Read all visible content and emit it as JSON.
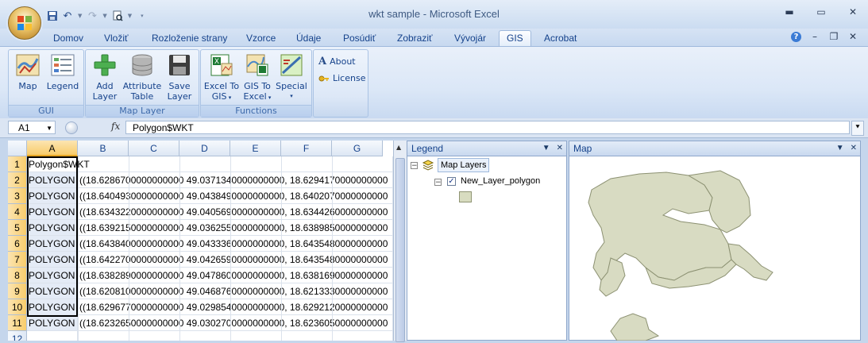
{
  "window": {
    "title": "wkt sample - Microsoft Excel",
    "controls": [
      "minimize",
      "maximize",
      "close"
    ]
  },
  "qat": {
    "items": [
      "save-icon",
      "undo-icon",
      "redo-icon",
      "print-preview-icon",
      "customize-icon"
    ]
  },
  "tabs": [
    {
      "label": "Domov"
    },
    {
      "label": "Vložiť"
    },
    {
      "label": "Rozloženie strany"
    },
    {
      "label": "Vzorce"
    },
    {
      "label": "Údaje"
    },
    {
      "label": "Posúdiť"
    },
    {
      "label": "Zobraziť"
    },
    {
      "label": "Vývojár"
    },
    {
      "label": "GIS",
      "active": true
    },
    {
      "label": "Acrobat"
    }
  ],
  "ribbon": {
    "groups": {
      "gui": {
        "label": "GUI",
        "buttons": [
          {
            "label": "Map",
            "icon": "map-icon"
          },
          {
            "label": "Legend",
            "icon": "legend-icon"
          }
        ]
      },
      "map_layer": {
        "label": "Map Layer",
        "buttons": [
          {
            "label_line1": "Add",
            "label_line2": "Layer",
            "icon": "add-icon"
          },
          {
            "label_line1": "Attribute",
            "label_line2": "Table",
            "icon": "database-icon"
          },
          {
            "label_line1": "Save",
            "label_line2": "Layer",
            "icon": "floppy-icon"
          }
        ]
      },
      "functions": {
        "label": "Functions",
        "buttons": [
          {
            "label_line1": "Excel To",
            "label_line2": "GIS",
            "icon": "excel-to-gis-icon"
          },
          {
            "label_line1": "GIS To",
            "label_line2": "Excel",
            "icon": "gis-to-excel-icon"
          },
          {
            "label_line1": "Special",
            "label_line2": "",
            "icon": "special-icon"
          }
        ]
      },
      "info": {
        "about": "About",
        "license": "License"
      }
    }
  },
  "formula_bar": {
    "name_box": "A1",
    "fx": "fx",
    "formula": "Polygon$WKT"
  },
  "sheet": {
    "columns": [
      "A",
      "B",
      "C",
      "D",
      "E",
      "F",
      "G"
    ],
    "selected_column": "A",
    "rows": [
      {
        "num": "1",
        "a": "Polygon$WKT",
        "b": ""
      },
      {
        "num": "2",
        "a": "POLYGON",
        "b": "((18.6286700000000000 49.0371340000000000, 18.6294170000000000"
      },
      {
        "num": "3",
        "a": "POLYGON",
        "b": "((18.6404930000000000 49.0438490000000000, 18.6402070000000000"
      },
      {
        "num": "4",
        "a": "POLYGON",
        "b": "((18.6343220000000000 49.0405690000000000, 18.6344260000000000"
      },
      {
        "num": "5",
        "a": "POLYGON",
        "b": "((18.6392150000000000 49.0362550000000000, 18.6389850000000000"
      },
      {
        "num": "6",
        "a": "POLYGON",
        "b": "((18.6438400000000000 49.0433360000000000, 18.6435480000000000"
      },
      {
        "num": "7",
        "a": "POLYGON",
        "b": "((18.6422700000000000 49.0426590000000000, 18.6435480000000000"
      },
      {
        "num": "8",
        "a": "POLYGON",
        "b": "((18.6382890000000000 49.0478600000000000, 18.6381690000000000"
      },
      {
        "num": "9",
        "a": "POLYGON",
        "b": "((18.6208100000000000 49.0468760000000000, 18.6213330000000000"
      },
      {
        "num": "10",
        "a": "POLYGON",
        "b": "((18.6296770000000000 49.0298540000000000, 18.6292120000000000"
      },
      {
        "num": "11",
        "a": "POLYGON",
        "b": "((18.6232650000000000 49.0302700000000000, 18.6236050000000000"
      },
      {
        "num": "12",
        "a": "",
        "b": ""
      }
    ]
  },
  "legend_pane": {
    "title": "Legend",
    "root": "Map Layers",
    "layer": "New_Layer_polygon",
    "layer_checked": true,
    "fill_color": "#d8dcc0"
  },
  "map_pane": {
    "title": "Map",
    "polygon_fill": "#d8dbc2",
    "polygon_stroke": "#8c9172"
  }
}
